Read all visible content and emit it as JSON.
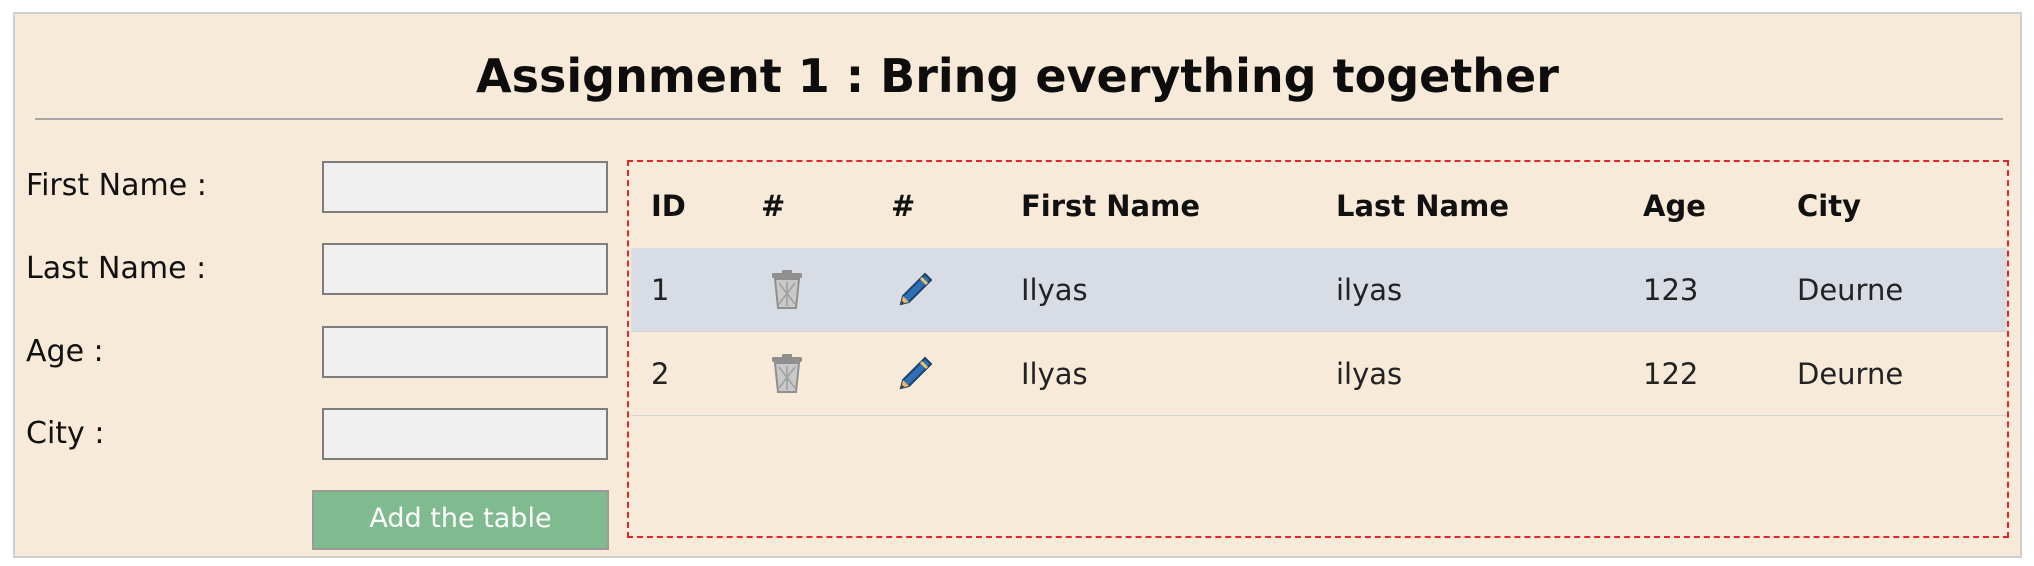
{
  "page": {
    "title": "Assignment 1 : Bring everything together"
  },
  "form": {
    "fields": [
      {
        "label": "First Name :",
        "value": "",
        "placeholder": ""
      },
      {
        "label": "Last Name :",
        "value": "",
        "placeholder": ""
      },
      {
        "label": "Age :",
        "value": "",
        "placeholder": ""
      },
      {
        "label": "City :",
        "value": "",
        "placeholder": ""
      }
    ],
    "submit_label": "Add the table"
  },
  "table": {
    "headers": [
      "ID",
      "#",
      "#",
      "First Name",
      "Last Name",
      "Age",
      "City"
    ],
    "rows": [
      {
        "id": "1",
        "delete_icon": "trash-icon",
        "edit_icon": "pencil-icon",
        "first_name": "Ilyas",
        "last_name": "ilyas",
        "age": "123",
        "city": "Deurne"
      },
      {
        "id": "2",
        "delete_icon": "trash-icon",
        "edit_icon": "pencil-icon",
        "first_name": "Ilyas",
        "last_name": "ilyas",
        "age": "122",
        "city": "Deurne"
      }
    ]
  },
  "colors": {
    "background": "#f7ead9",
    "button": "#7fbb8e",
    "row_highlight": "#d8dde5",
    "table_border": "#e2262c"
  }
}
